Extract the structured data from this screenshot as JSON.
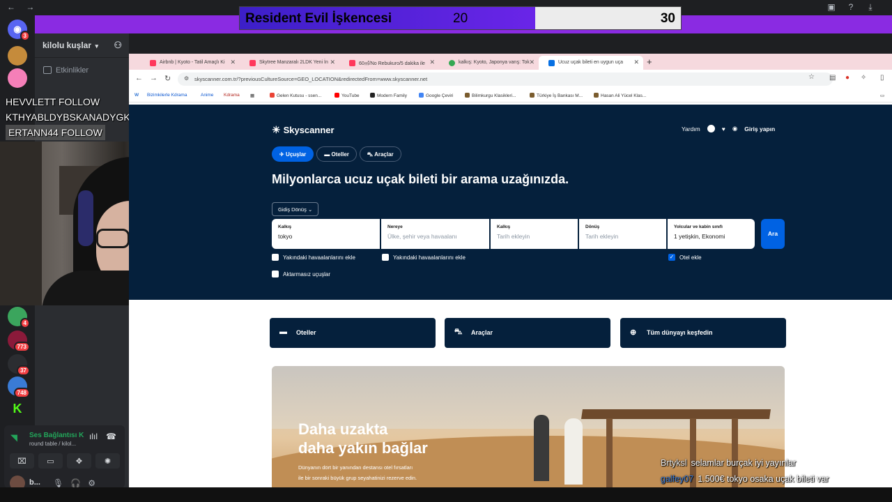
{
  "overlay": {
    "match_title": "Resident Evil İşkencesi",
    "score_a": "20",
    "score_b": "30"
  },
  "follows": [
    "HEVVLETT  FOLLOW",
    "KTHYABLDYBSKANADYGKHNAKSN  FOLLOW",
    "ERTANN44  FOLLOW"
  ],
  "discord": {
    "server_name": "kilolu kuşlar",
    "events_label": "Etkinlikler",
    "servers": [
      {
        "name": "discord-home",
        "glyph": "◉",
        "color": "#5865f2",
        "badge": "3"
      },
      {
        "name": "server-1",
        "glyph": "",
        "color": "#c58b3b",
        "badge": ""
      },
      {
        "name": "server-2",
        "glyph": "",
        "color": "#f57fb8",
        "badge": ""
      },
      {
        "name": "server-3",
        "glyph": "",
        "color": "#3ba55d",
        "badge": "4"
      },
      {
        "name": "server-4",
        "glyph": "",
        "color": "#8b1a3a",
        "badge": "773"
      },
      {
        "name": "server-5",
        "glyph": "",
        "color": "#2b2d31",
        "badge": "37"
      },
      {
        "name": "server-6",
        "glyph": "",
        "color": "#3a7bd5",
        "badge": "748"
      },
      {
        "name": "server-7",
        "glyph": "K",
        "color": "#1e1f22",
        "badge": ""
      }
    ],
    "voice_title": "Ses Bağlantısı K",
    "voice_sub": "round table / kilol...",
    "user_name": "b..."
  },
  "browser": {
    "tabs": [
      {
        "title": "Airbnb | Kyoto - Tatil Amaçlı Ki",
        "color": "#ff385c"
      },
      {
        "title": "Skytree Manzaralı 2LDK Yeni İn",
        "color": "#ff385c"
      },
      {
        "title": "60㎡/No Rebukuro/5 dakika ile",
        "color": "#ff385c"
      },
      {
        "title": "kalkış: Kyoto, Japonya varış: Tok",
        "color": "#34a853"
      },
      {
        "title": "Ucuz uçak bileti en uygun uça",
        "color": "#0770e3"
      }
    ],
    "url": "skyscanner.com.tr/?previousCultureSource=GEO_LOCATION&redirectedFrom=www.skyscanner.net",
    "bookmarks": [
      "Bizimkilerle Kdrama",
      "Anime",
      "Kdrama",
      "Gelen Kutusu - ssen...",
      "YouTube",
      "Modern Family",
      "Google Çeviri",
      "Bilimkurgu Klasikleri...",
      "Türkiye İş Bankası M...",
      "Hasan Ali Yücel Klas..."
    ]
  },
  "sky": {
    "logo": "Skyscanner",
    "help": "Yardım",
    "login": "Giriş yapın",
    "tabs": [
      "Uçuşlar",
      "Oteller",
      "Araçlar"
    ],
    "headline": "Milyonlarca ucuz uçak bileti bir arama uzağınızda.",
    "trip_type": "Gidiş Dönüş",
    "from_label": "Kalkış",
    "from_value": "tokyo",
    "to_label": "Nereye",
    "to_placeholder": "Ülke, şehir veya havaalanı",
    "depart_label": "Kalkış",
    "depart_placeholder": "Tarih ekleyin",
    "return_label": "Dönüş",
    "return_placeholder": "Tarih ekleyin",
    "pax_label": "Yolcular ve kabin sınıfı",
    "pax_value": "1 yetişkin, Ekonomi",
    "search": "Ara",
    "nearby1": "Yakındaki havaalanlarını ekle",
    "nearby2": "Yakındaki havaalanlarını ekle",
    "hotel_check": "Otel ekle",
    "direct": "Aktarmasız uçuşlar",
    "quick": [
      "Oteller",
      "Araçlar",
      "Tüm dünyayı keşfedin"
    ],
    "banner_t1": "Daha uzakta",
    "banner_t2": "daha yakın bağlar",
    "banner_s1": "Dünyanın dört bir yanından destansı otel fırsatları",
    "banner_s2": "ile bir sonraki büyük grup seyahatinizi rezerve edin."
  },
  "chat": [
    {
      "user": "Brtyksl",
      "msg": "selamlar burçak iyi yayınlar"
    },
    {
      "user": "galfey07",
      "msg": "1.500€ tokyo osaka uçak bileti var"
    }
  ]
}
